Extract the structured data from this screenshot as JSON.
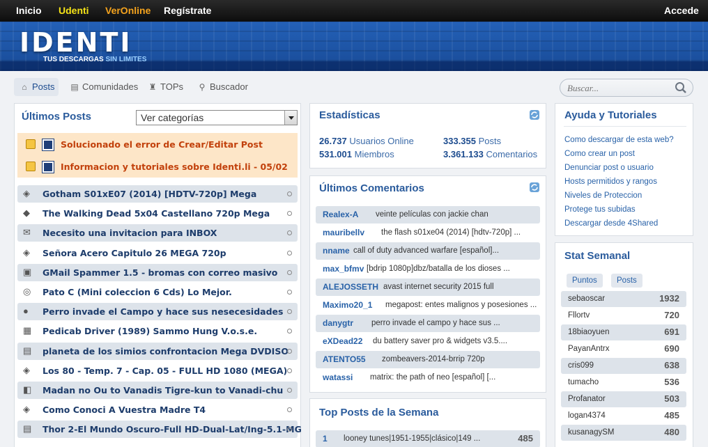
{
  "topnav": {
    "inicio": "Inicio",
    "udenti": "Udenti",
    "veronline": "VerOnline",
    "registrate": "Regístrate",
    "accede": "Accede"
  },
  "brand": {
    "logo": "IDENTI",
    "tagline_a": "TUS DESCARGAS",
    "tagline_b": "SIN LIMITES"
  },
  "nav": {
    "posts": "Posts",
    "comunidades": "Comunidades",
    "tops": "TOPs",
    "buscador": "Buscador"
  },
  "search": {
    "placeholder": "Buscar..."
  },
  "posts": {
    "title": "Últimos Posts",
    "category_select": "Ver categorías",
    "sticky": [
      "Solucionado el error de Crear/Editar Post",
      "Informacion y tutoriales sobre Identi.li - 05/02"
    ],
    "items": [
      "Gotham S01xE07 (2014) [HDTV-720p] Mega",
      "The Walking Dead 5x04 Castellano 720p Mega",
      "Necesito una invitacion para INBOX",
      "Señora Acero Capitulo 26 MEGA 720p",
      "GMail Spammer 1.5 - bromas con correo masivo",
      "Pato C (Mini coleccion 6 Cds) Lo Mejor.",
      "Perro invade el Campo y hace sus nesecesidades",
      "Pedicab Driver (1989) Sammo Hung V.o.s.e.",
      "planeta de los simios confrontacion Mega DVDISO",
      "Los 80 - Temp. 7 - Cap. 05 - FULL HD 1080 (MEGA)",
      "Madan no Ou to Vanadis Tigre-kun to Vanadi-chu",
      "Como Conoci A Vuestra Madre T4",
      "Thor 2-El Mundo Oscuro-Full HD-Dual-Lat/Ing-5.1-MG"
    ]
  },
  "stats": {
    "title": "Estadísticas",
    "online_num": "26.737",
    "online_label": "Usuarios Online",
    "posts_num": "333.355",
    "posts_label": "Posts",
    "members_num": "531.001",
    "members_label": "Miembros",
    "comments_num": "3.361.133",
    "comments_label": "Comentarios"
  },
  "comments": {
    "title": "Últimos Comentarios",
    "items": [
      {
        "user": "Realex-A",
        "text": "veinte películas con jackie chan"
      },
      {
        "user": "mauribellv",
        "text": "the flash s01xe04 (2014) [hdtv-720p] ..."
      },
      {
        "user": "nname",
        "text": "call of duty advanced warfare [español]..."
      },
      {
        "user": "max_bfmv",
        "text": "[bdrip 1080p]dbz/batalla de los dioses ..."
      },
      {
        "user": "ALEJOSSETH",
        "text": "avast internet security 2015 full"
      },
      {
        "user": "Maximo20_1",
        "text": "megapost: entes malignos y posesiones ..."
      },
      {
        "user": "danygtr",
        "text": "perro invade el campo y hace sus ..."
      },
      {
        "user": "eXDead22",
        "text": "du battery saver pro & widgets v3.5...."
      },
      {
        "user": "ATENTO55",
        "text": "zombeavers-2014-brrip 720p"
      },
      {
        "user": "watassi",
        "text": "matrix: the path of neo [español] [..."
      }
    ]
  },
  "top_posts": {
    "title": "Top Posts de la Semana",
    "items": [
      {
        "rank": "1",
        "text": "looney tunes|1951-1955|clásico|149 ...",
        "points": "485"
      }
    ]
  },
  "help": {
    "title": "Ayuda y Tutoriales",
    "links": [
      "Como descargar de esta web?",
      "Como crear un post",
      "Denunciar post o usuario",
      "Hosts permitidos y rangos",
      "Niveles de Proteccion",
      "Protege tus subidas",
      "Descargar desde 4Shared"
    ]
  },
  "weekly": {
    "title": "Stat Semanal",
    "tab_points": "Puntos",
    "tab_posts": "Posts",
    "rows": [
      {
        "name": "sebaoscar",
        "value": "1932"
      },
      {
        "name": "Fllortv",
        "value": "720"
      },
      {
        "name": "18biaoyuen",
        "value": "691"
      },
      {
        "name": "PayanAntrx",
        "value": "690"
      },
      {
        "name": "cris099",
        "value": "638"
      },
      {
        "name": "tumacho",
        "value": "536"
      },
      {
        "name": "Profanator",
        "value": "503"
      },
      {
        "name": "logan4374",
        "value": "485"
      },
      {
        "name": "kusanagySM",
        "value": "480"
      }
    ]
  }
}
